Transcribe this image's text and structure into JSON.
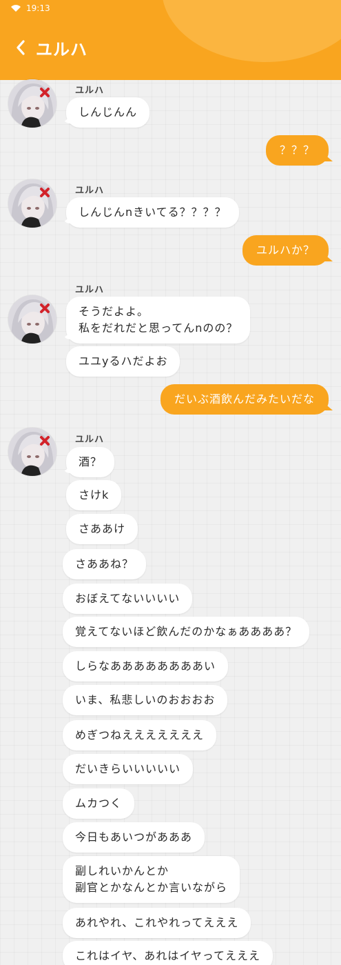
{
  "status_bar": {
    "time": "19:13"
  },
  "header": {
    "title": "ユルハ"
  },
  "messages": [
    {
      "sender": "ユルハ",
      "text": "しんじんん"
    },
    {
      "sender": "me",
      "text": "？？？"
    },
    {
      "sender": "ユルハ",
      "text": "しんじんnきいてる？？？？"
    },
    {
      "sender": "me",
      "text": "ユルハか？"
    },
    {
      "sender": "ユルハ",
      "text": "そうだよよ。\n私をだれだと思ってんnのの？"
    },
    {
      "sender": "ユルハ",
      "text": "ユユyるハだよお"
    },
    {
      "sender": "me",
      "text": "だいぶ酒飲んだみたいだな"
    },
    {
      "sender": "ユルハ",
      "text": "酒？"
    },
    {
      "sender": "ユルハ",
      "text": "さけk"
    },
    {
      "sender": "ユルハ",
      "text": "さああけ"
    },
    {
      "sender": "ユルハ",
      "text": "さああね？"
    },
    {
      "sender": "ユルハ",
      "text": "おぼえてないいいい"
    },
    {
      "sender": "ユルハ",
      "text": "覚えてないほど飲んだのかなぁああああ？"
    },
    {
      "sender": "ユルハ",
      "text": "しらなああああああああい"
    },
    {
      "sender": "ユルハ",
      "text": "いま、私悲しいのおおおお"
    },
    {
      "sender": "ユルハ",
      "text": "めぎつねえええええええ"
    },
    {
      "sender": "ユルハ",
      "text": "だいきらいいいいい"
    },
    {
      "sender": "ユルハ",
      "text": "ムカつく"
    },
    {
      "sender": "ユルハ",
      "text": "今日もあいつがあああ"
    },
    {
      "sender": "ユルハ",
      "text": "副しれいかんとか\n副官とかなんとか言いながら"
    },
    {
      "sender": "ユルハ",
      "text": "あれやれ、これやれってえええ"
    },
    {
      "sender": "ユルハ",
      "text": "これはイヤ、あれはイヤってえええ"
    }
  ],
  "colors": {
    "accent": "#f9a51f",
    "bubble_in": "#ffffff",
    "background": "#f0f0f0"
  },
  "icons": {
    "back": "chevron-left-icon",
    "wifi": "wifi-icon",
    "avatar": "character-avatar"
  }
}
